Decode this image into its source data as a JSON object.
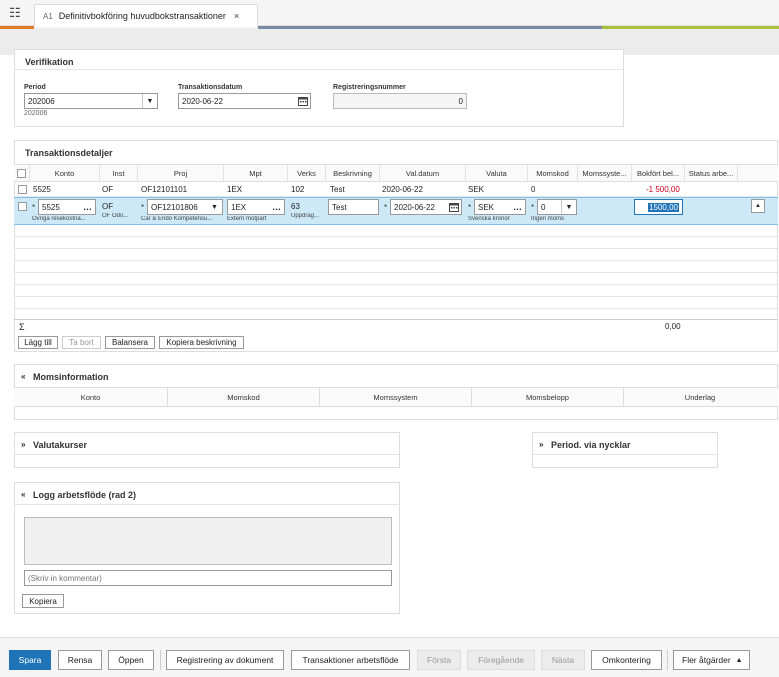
{
  "tab": {
    "code": "A1",
    "title": "Definitivbokföring huvudbokstransaktioner",
    "close": "×"
  },
  "icons": {
    "menu": "list-icon",
    "close": "close-icon",
    "dropdown": "chevron-down-icon",
    "calendar": "calendar-icon",
    "more": "ellipsis-icon",
    "collapse": "chevron-double-up-icon",
    "expand": "chevron-double-down-icon",
    "sort": "triangle-up-icon"
  },
  "verifikation": {
    "title": "Verifikation",
    "period_label": "Period",
    "period_value": "202006",
    "period_sub": "202006",
    "trans_date_label": "Transaktionsdatum",
    "trans_date_value": "2020-06-22",
    "regnr_label": "Registreringsnummer",
    "regnr_value": "0"
  },
  "transaktion": {
    "title": "Transaktionsdetaljer",
    "columns": [
      "Konto",
      "Inst",
      "Proj",
      "Mpt",
      "Verks",
      "Beskrivning",
      "Val.datum",
      "Valuta",
      "Momskod",
      "Momssyste...",
      "Bokfört bel...",
      "Status arbe..."
    ],
    "row1": {
      "konto": "5525",
      "inst": "OF",
      "proj": "OF12101101",
      "mpt": "1EX",
      "verks": "102",
      "beskr": "Test",
      "valdatum": "2020-06-22",
      "valuta": "SEK",
      "momskod": "0",
      "belopp": "-1 500,00"
    },
    "row2": {
      "konto": "5525",
      "konto_sub": "Övriga resekostna...",
      "inst": "OF",
      "inst_sub": "OF Odo...",
      "proj": "OF12101806",
      "proj_sub": "Car & Endo Kompetensu...",
      "mpt": "1EX",
      "mpt_sub": "Extern motpart",
      "verks": "63",
      "verks_sub": "Uppdrag...",
      "beskr": "Test",
      "valdatum": "2020-06-22",
      "valuta": "SEK",
      "valuta_sub": "Svenska kronor",
      "momskod": "0",
      "momskod_sub": "Ingen moms",
      "belopp": "1500,00"
    },
    "sum_symbol": "Σ",
    "sum_value": "0,00",
    "required": "*",
    "buttons": {
      "add": "Lägg till",
      "remove": "Ta bort",
      "balance": "Balansera",
      "copy_desc": "Kopiera beskrivning"
    }
  },
  "moms": {
    "title": "Momsinformation",
    "columns": [
      "Konto",
      "Momskod",
      "Momssystem",
      "Momsbelopp",
      "Underlag"
    ]
  },
  "valuta": {
    "title": "Valutakurser"
  },
  "period_nycklar": {
    "title": "Period. via nycklar"
  },
  "logg": {
    "title": "Logg arbetsflöde (rad 2)",
    "comment_placeholder": "(Skriv in kommentar)",
    "copy_button": "Kopiera"
  },
  "footer": {
    "save": "Spara",
    "clear": "Rensa",
    "open": "Öppen",
    "doc_reg": "Registrering av dokument",
    "trans_flow": "Transaktioner arbetsflöde",
    "first": "Första",
    "prev": "Föregående",
    "next": "Nästa",
    "rekontering": "Omkontering",
    "more_actions": "Fler åtgärder"
  },
  "colors": {
    "accent_blue": "#1f73b7",
    "selected_row": "#cde9f7",
    "negative": "#d0021b"
  }
}
